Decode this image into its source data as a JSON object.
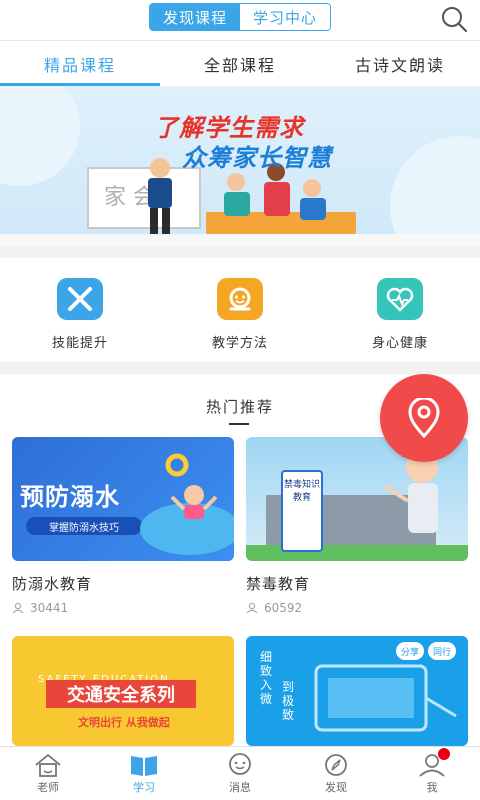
{
  "header": {
    "segments": [
      {
        "label": "发现课程",
        "active": true
      },
      {
        "label": "学习中心",
        "active": false
      }
    ],
    "accent_color": "#3aa6e8"
  },
  "tabs": [
    {
      "label": "精品课程",
      "active": true
    },
    {
      "label": "全部课程",
      "active": false
    },
    {
      "label": "古诗文朗读",
      "active": false
    }
  ],
  "banner": {
    "line1": "了解学生需求",
    "line2": "众筹家长智慧",
    "board_text": "家长会"
  },
  "categories": [
    {
      "label": "技能提升",
      "icon": "skill-icon",
      "color": "#3aa6e8"
    },
    {
      "label": "教学方法",
      "icon": "teaching-icon",
      "color": "#f5a623"
    },
    {
      "label": "身心健康",
      "icon": "health-icon",
      "color": "#35c4b8"
    }
  ],
  "hot": {
    "title": "热门推荐",
    "courses": [
      {
        "title": "防溺水教育",
        "views": "30441",
        "image_text": "预防溺水",
        "image_sub": "掌握防溺水技巧"
      },
      {
        "title": "禁毒教育",
        "views": "60592",
        "image_text": "禁毒知识教育"
      },
      {
        "title": "",
        "views": "",
        "image_text": "交通安全系列",
        "image_sub": "文明出行 从我做起",
        "image_top": "SAFETY EDUCATION"
      },
      {
        "title": "",
        "views": "",
        "image_text": "细致入微",
        "image_sub": "到极致",
        "badge": "分享",
        "badge2": "同行"
      }
    ]
  },
  "bottom_nav": [
    {
      "label": "老师",
      "icon": "house-icon",
      "active": false
    },
    {
      "label": "学习",
      "icon": "book-icon",
      "active": true
    },
    {
      "label": "消息",
      "icon": "message-icon",
      "active": false
    },
    {
      "label": "发现",
      "icon": "compass-icon",
      "active": false
    },
    {
      "label": "我",
      "icon": "profile-icon",
      "active": false,
      "has_badge": true
    }
  ]
}
